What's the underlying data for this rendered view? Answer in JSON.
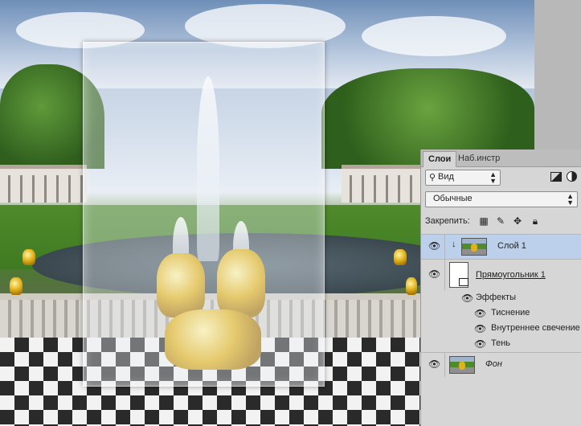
{
  "canvas": {
    "description_icon": "photo-canvas"
  },
  "panel": {
    "tabs": [
      {
        "label": "Слои",
        "active": true
      },
      {
        "label": "Наб.инстр",
        "active": false
      }
    ],
    "close_glyph": "»",
    "filter": {
      "icon": "search-icon",
      "label": "Вид"
    },
    "blend_mode": "Обычные",
    "lock_label": "Закрепить:",
    "layers": [
      {
        "name": "Слой 1",
        "selected": true,
        "clipped": true,
        "thumb": "photo"
      },
      {
        "name": "Прямоугольник 1",
        "selected": false,
        "thumb": "white-shape",
        "effects_label": "Эффекты",
        "effects": [
          "Тиснение",
          "Внутреннее свечение",
          "Тень"
        ]
      },
      {
        "name": "Фон",
        "selected": false,
        "thumb": "photo"
      }
    ],
    "selection_color": "#bcd0ec",
    "panel_color": "#d6d6d6"
  }
}
